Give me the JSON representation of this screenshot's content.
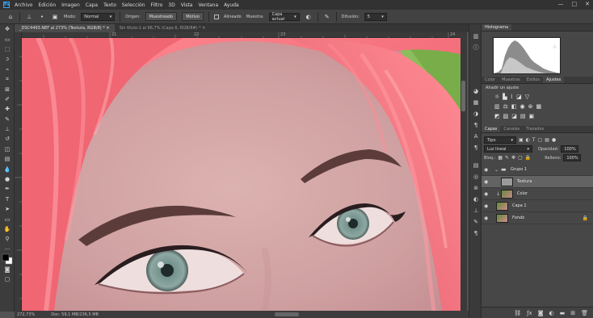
{
  "app": {
    "logo": "Ps"
  },
  "menubar": {
    "items": [
      "Archivo",
      "Edición",
      "Imagen",
      "Capa",
      "Texto",
      "Selección",
      "Filtro",
      "3D",
      "Vista",
      "Ventana",
      "Ayuda"
    ],
    "window_controls": [
      "—",
      "□",
      "✕"
    ]
  },
  "options": {
    "mode_label": "Modo:",
    "mode_value": "Normal",
    "origin_label": "Origen:",
    "origin_sampled": "Muestreado",
    "origin_pattern": "Motivo",
    "aligned_label": "Alineado",
    "sample_label": "Muestra:",
    "sample_value": "Capa actual",
    "diffusion_label": "Difusión:",
    "diffusion_value": "5"
  },
  "tabs": [
    {
      "label": "_DSC4493.NEF al 273% (Textura, RGB/8) *  ✕",
      "active": true
    },
    {
      "label": "Sin título-1 al 66,7% (Capa 6, RGB/8#) *  ✕",
      "active": false
    }
  ],
  "rulers": {
    "top": [
      "21",
      "22",
      "23",
      "24"
    ],
    "left": []
  },
  "statusbar": {
    "zoom": "272,73%",
    "doc": "Doc: 59,1 MB/236,5 MB"
  },
  "panels": {
    "histogram_tab": "Histograma",
    "adjust_tabs": [
      "Color",
      "Muestras",
      "Estilos",
      "Ajustes"
    ],
    "adjust_active": "Ajustes",
    "adjust_title": "Añadir un ajuste",
    "layers_tabs": [
      "Capas",
      "Canales",
      "Trazados"
    ],
    "layers_active": "Capas",
    "filter_kind": "Tipo",
    "blend_mode": "Luz lineal",
    "opacity_label": "Opacidad:",
    "opacity_value": "100%",
    "lock_label": "Bloq.:",
    "fill_label": "Relleno:",
    "fill_value": "100%"
  },
  "layers": [
    {
      "name": "Grupo 1",
      "type": "group",
      "selected": false
    },
    {
      "name": "Textura",
      "type": "layer",
      "selected": true
    },
    {
      "name": "Color",
      "type": "layer",
      "selected": false
    },
    {
      "name": "Capa 1",
      "type": "layer",
      "selected": false
    },
    {
      "name": "Fondo",
      "type": "background",
      "selected": false
    }
  ]
}
